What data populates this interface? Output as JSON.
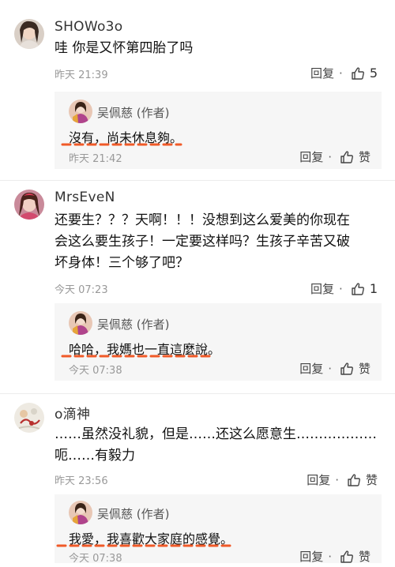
{
  "comments": [
    {
      "user": "SHOWo3o",
      "text": "哇 你是又怀第四胎了吗",
      "time": "昨天 21:39",
      "reply_label": "回复",
      "separator": "·",
      "likes": "5",
      "reply": {
        "user": "吴佩慈 (作者)",
        "text": "沒有，尚未休息夠。",
        "time": "昨天 21:42",
        "reply_label": "回复",
        "separator": "·",
        "like_label": "赞"
      }
    },
    {
      "user": "MrsEveN",
      "text_lines": [
        "还要生？？？天啊！！！没想到这么爱美的你现在",
        "会这么要生孩子！一定要这样吗？生孩子辛苦又破",
        "坏身体！三个够了吧？"
      ],
      "time": "今天 07:23",
      "reply_label": "回复",
      "separator": "·",
      "likes": "1",
      "reply": {
        "user": "吴佩慈 (作者)",
        "text": "哈哈，我媽也一直這麼說。",
        "time": "今天 07:38",
        "reply_label": "回复",
        "separator": "·",
        "like_label": "赞"
      }
    },
    {
      "user": "o滴神",
      "text_lines": [
        "……虽然没礼貌，但是……还这么愿意生………………",
        "呃……有毅力"
      ],
      "time": "昨天 23:56",
      "reply_label": "回复",
      "separator": "·",
      "like_label": "赞",
      "reply": {
        "user": "吴佩慈 (作者)",
        "text": "我愛，我喜歡大家庭的感覺。",
        "time": "今天 07:38",
        "reply_label": "回复",
        "separator": "·",
        "like_label": "赞"
      }
    }
  ],
  "colors": {
    "underline": "#f05a28",
    "reply_bg": "#f6f6f6",
    "time": "#999999"
  },
  "icons": [
    "avatar",
    "thumb-up-icon"
  ]
}
